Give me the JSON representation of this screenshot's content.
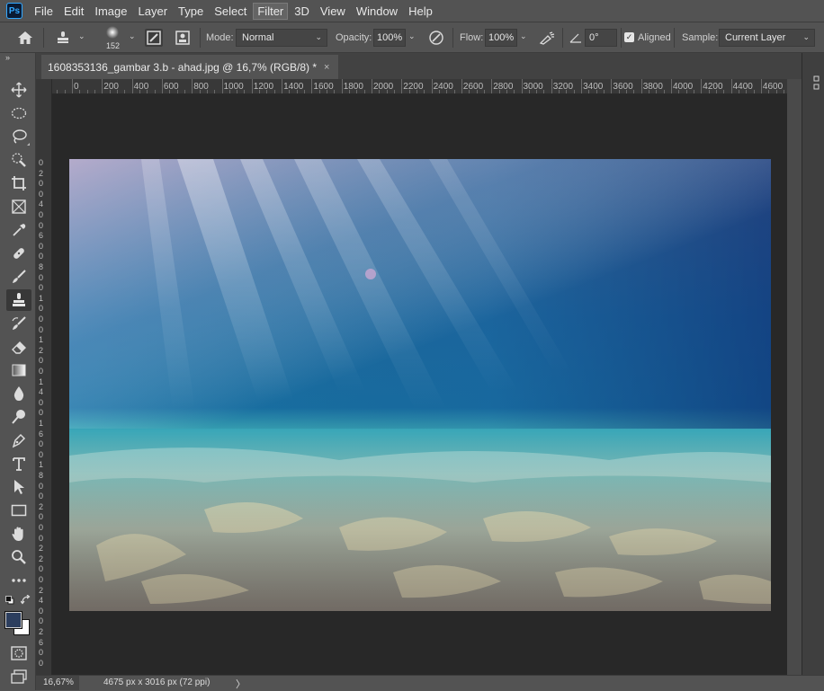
{
  "app": {
    "logo": "Ps"
  },
  "menu": [
    "File",
    "Edit",
    "Image",
    "Layer",
    "Type",
    "Select",
    "Filter",
    "3D",
    "View",
    "Window",
    "Help"
  ],
  "menu_active": "Filter",
  "options": {
    "brush_size": "152",
    "mode_label": "Mode:",
    "mode_value": "Normal",
    "opacity_label": "Opacity:",
    "opacity_value": "100%",
    "flow_label": "Flow:",
    "flow_value": "100%",
    "angle_value": "0°",
    "aligned_label": "Aligned",
    "aligned_checked": true,
    "sample_label": "Sample:",
    "sample_value": "Current Layer"
  },
  "document": {
    "tab_title": "1608353136_gambar 3.b - ahad.jpg @ 16,7% (RGB/8) *",
    "close_glyph": "×"
  },
  "ruler": {
    "h_labels": [
      "0",
      "200",
      "400",
      "600",
      "800",
      "1000",
      "1200",
      "1400",
      "1600",
      "1800",
      "2000",
      "2200",
      "2400",
      "2600",
      "2800",
      "3000",
      "3200",
      "3400",
      "3600",
      "3800",
      "4000",
      "4200",
      "4400",
      "4600"
    ],
    "v_labels": [
      "0",
      "2",
      "0",
      "0",
      "4",
      "0",
      "0",
      "6",
      "0",
      "0",
      "8",
      "0",
      "0",
      "1",
      "0",
      "0",
      "0",
      "1",
      "2",
      "0",
      "0",
      "1",
      "4",
      "0",
      "0",
      "1",
      "6",
      "0",
      "0",
      "1",
      "8",
      "0",
      "0",
      "2",
      "0",
      "0",
      "0",
      "2",
      "2",
      "0",
      "0",
      "2",
      "4",
      "0",
      "0",
      "2",
      "6",
      "0",
      "0",
      "2",
      "8",
      "0",
      "0"
    ]
  },
  "tools": [
    {
      "name": "move-tool",
      "icon": "move-icon"
    },
    {
      "name": "marquee-tool",
      "icon": "ellipse-marquee-icon"
    },
    {
      "name": "lasso-tool",
      "icon": "lasso-icon"
    },
    {
      "name": "quick-select-tool",
      "icon": "quick-select-icon"
    },
    {
      "name": "crop-tool",
      "icon": "crop-icon"
    },
    {
      "name": "frame-tool",
      "icon": "frame-icon"
    },
    {
      "name": "eyedropper-tool",
      "icon": "eyedropper-icon"
    },
    {
      "name": "healing-tool",
      "icon": "bandage-icon"
    },
    {
      "name": "brush-tool",
      "icon": "brush-icon"
    },
    {
      "name": "clone-stamp-tool",
      "icon": "stamp-icon",
      "active": true
    },
    {
      "name": "history-brush-tool",
      "icon": "history-brush-icon"
    },
    {
      "name": "eraser-tool",
      "icon": "eraser-icon"
    },
    {
      "name": "gradient-tool",
      "icon": "gradient-icon"
    },
    {
      "name": "blur-tool",
      "icon": "drop-icon"
    },
    {
      "name": "dodge-tool",
      "icon": "dodge-icon"
    },
    {
      "name": "pen-tool",
      "icon": "pen-icon"
    },
    {
      "name": "type-tool",
      "icon": "type-icon"
    },
    {
      "name": "path-select-tool",
      "icon": "arrow-icon"
    },
    {
      "name": "rectangle-tool",
      "icon": "rectangle-icon"
    },
    {
      "name": "hand-tool",
      "icon": "hand-icon"
    },
    {
      "name": "zoom-tool",
      "icon": "magnifier-icon"
    },
    {
      "name": "more-tools",
      "icon": "ellipsis-icon"
    }
  ],
  "colors": {
    "foreground": "#2c3e5e",
    "background": "#ffffff"
  },
  "status": {
    "zoom": "16,67%",
    "info": "4675 px x 3016 px (72 ppi)",
    "arrow": "〉"
  }
}
